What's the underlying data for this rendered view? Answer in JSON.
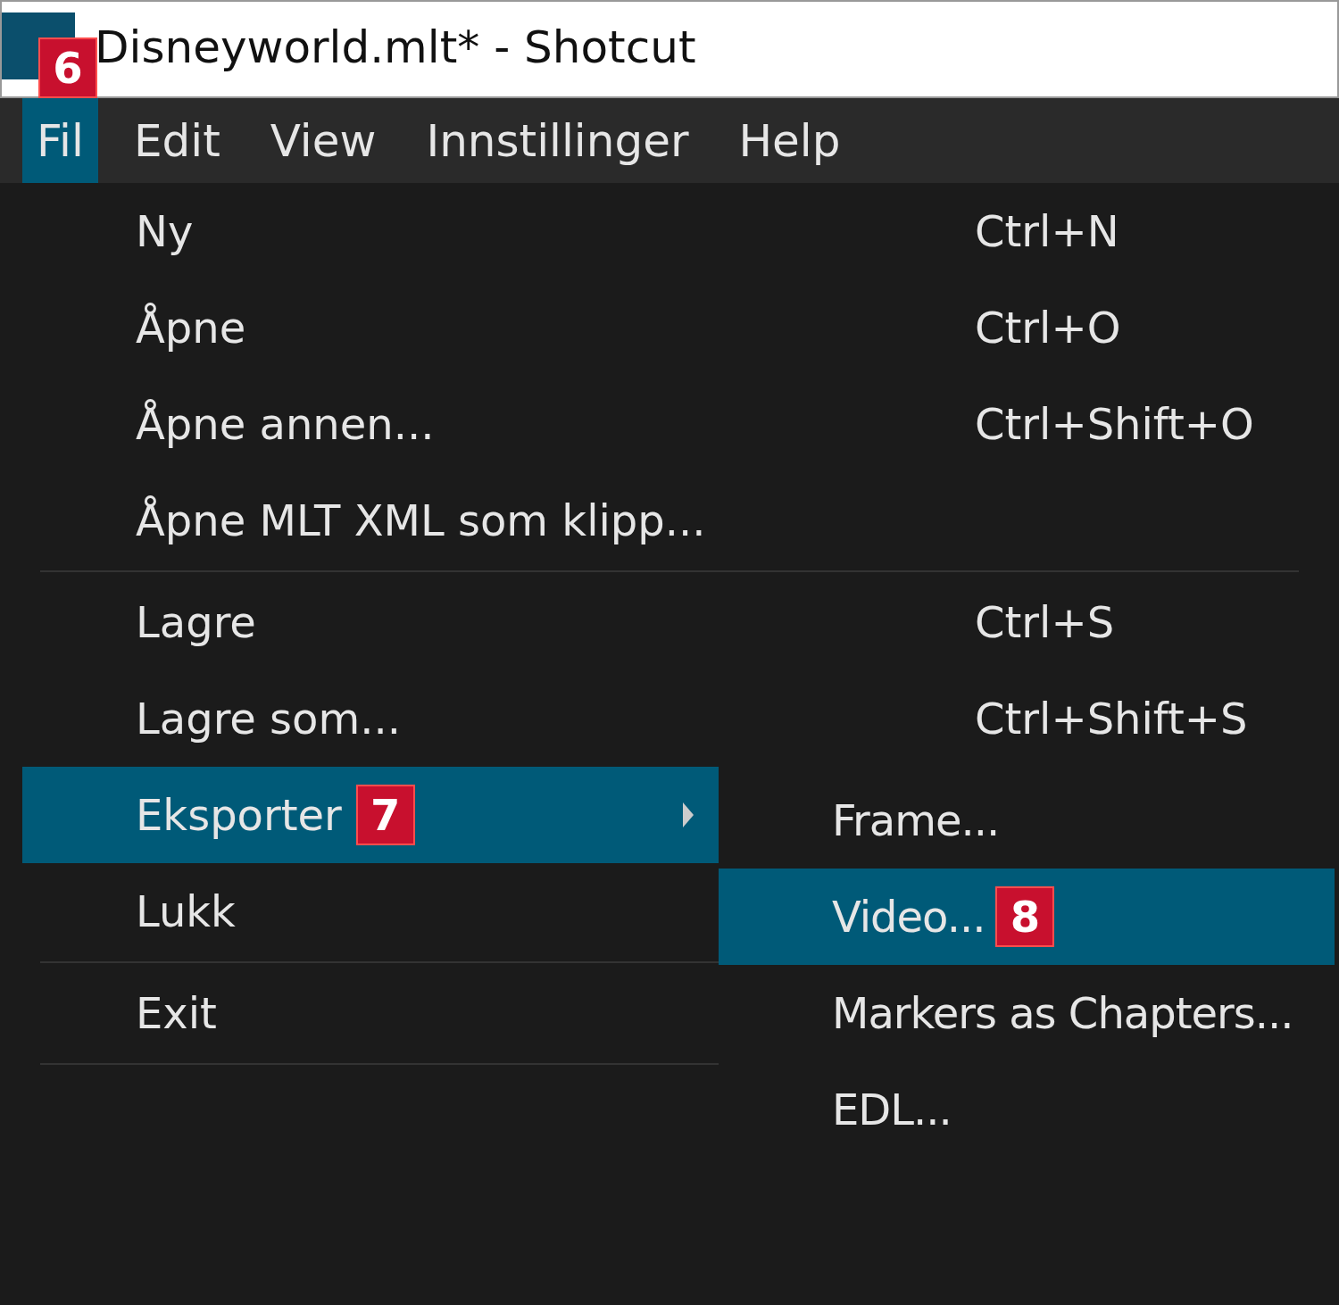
{
  "window": {
    "title": "Disneyworld.mlt* - Shotcut"
  },
  "menu_bar": [
    {
      "label": "Fil",
      "selected": true,
      "badge": "6"
    },
    {
      "label": "Edit",
      "selected": false
    },
    {
      "label": "View",
      "selected": false
    },
    {
      "label": "Innstillinger",
      "selected": false
    },
    {
      "label": "Help",
      "selected": false
    }
  ],
  "menu": {
    "items": [
      {
        "kind": "item",
        "label": "Ny",
        "shortcut": "Ctrl+N",
        "selected": false
      },
      {
        "kind": "item",
        "label": "Åpne",
        "shortcut": "Ctrl+O",
        "selected": false
      },
      {
        "kind": "item",
        "label": "Åpne annen...",
        "shortcut": "Ctrl+Shift+O",
        "selected": false
      },
      {
        "kind": "item",
        "label": "Åpne MLT XML som klipp...",
        "selected": false
      },
      {
        "kind": "separator"
      },
      {
        "kind": "item",
        "label": "Lagre",
        "shortcut": "Ctrl+S",
        "selected": false
      },
      {
        "kind": "item",
        "label": "Lagre som...",
        "shortcut": "Ctrl+Shift+S",
        "selected": false
      },
      {
        "kind": "submenu",
        "label": "Eksporter",
        "selected": true,
        "badge": "7"
      },
      {
        "kind": "item",
        "label": "Lukk",
        "selected": false
      },
      {
        "kind": "separator"
      },
      {
        "kind": "item",
        "label": "Exit",
        "selected": false
      },
      {
        "kind": "separator"
      }
    ]
  },
  "submenu": {
    "items": [
      {
        "label": "Frame...",
        "selected": false
      },
      {
        "label": "Video...",
        "selected": true,
        "badge": "8"
      },
      {
        "label": "Markers as Chapters...",
        "selected": false
      },
      {
        "label": "EDL...",
        "selected": false
      }
    ]
  }
}
